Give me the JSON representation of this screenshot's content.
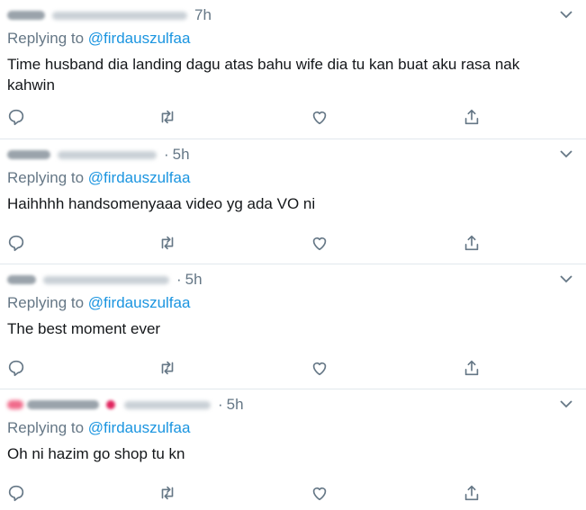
{
  "replying_prefix": "Replying to",
  "colors": {
    "link": "#1b95e0",
    "muted": "#657786",
    "text": "#14171a",
    "divider": "#e1e8ed"
  },
  "icons": {
    "reply": "reply-icon",
    "retweet": "retweet-icon",
    "like": "like-icon",
    "share": "share-icon",
    "menu": "chevron-down-icon"
  },
  "tweets": [
    {
      "time": "7h",
      "reply_to": "@firdauszulfaa",
      "text": "Time husband dia landing dagu atas bahu wife dia tu kan buat aku rasa nak kahwin"
    },
    {
      "time": "5h",
      "reply_to": "@firdauszulfaa",
      "text": "Haihhhh handsomenyaaa video yg ada VO ni"
    },
    {
      "time": "5h",
      "reply_to": "@firdauszulfaa",
      "text": "The best moment ever"
    },
    {
      "time": "5h",
      "reply_to": "@firdauszulfaa",
      "text": "Oh ni hazim go shop tu kn"
    }
  ]
}
